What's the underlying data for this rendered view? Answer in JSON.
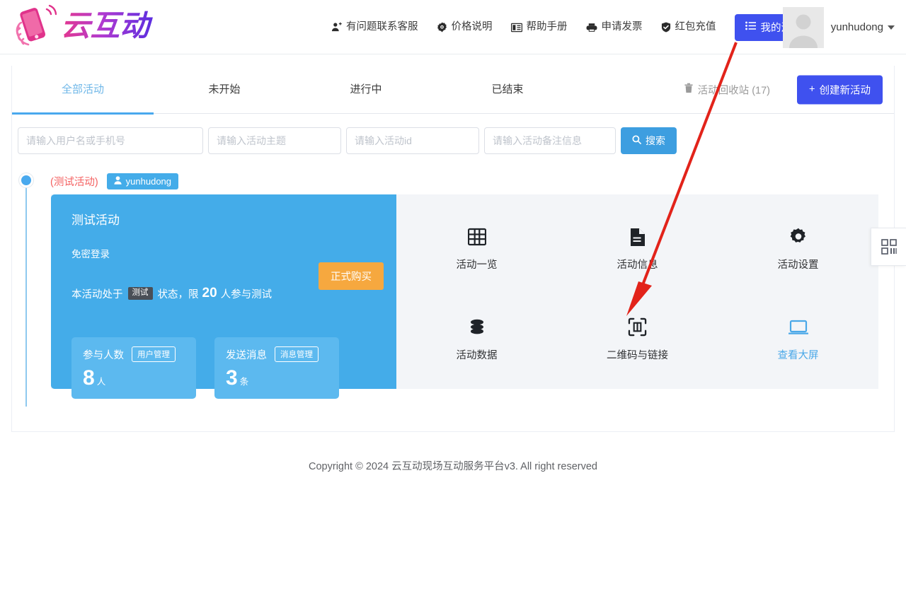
{
  "header": {
    "logo_text": "云互动",
    "logo_icon": "hand-phone-logo-icon",
    "nav": [
      {
        "icon": "user-support-icon",
        "label": "有问题联系客服"
      },
      {
        "icon": "gear-badge-icon",
        "label": "价格说明"
      },
      {
        "icon": "book-icon",
        "label": "帮助手册"
      },
      {
        "icon": "printer-icon",
        "label": "申请发票"
      },
      {
        "icon": "shield-check-icon",
        "label": "红包充值"
      }
    ],
    "my_activities_button": {
      "icon": "list-icon",
      "label": "我的活动"
    },
    "user": {
      "name": "yunhudong",
      "avatar_icon": "avatar-placeholder-icon",
      "caret": "chevron-down-icon"
    }
  },
  "tabs": [
    {
      "label": "全部活动",
      "active": true
    },
    {
      "label": "未开始",
      "active": false
    },
    {
      "label": "进行中",
      "active": false
    },
    {
      "label": "已结束",
      "active": false
    }
  ],
  "recycle_bin": {
    "icon": "trash-icon",
    "label": "活动回收站 (17)"
  },
  "create_button": {
    "icon": "plus-icon",
    "label": "创建新活动"
  },
  "search": {
    "fields": [
      {
        "name": "username-or-phone",
        "placeholder": "请输入用户名或手机号",
        "value": ""
      },
      {
        "name": "activity-title",
        "placeholder": "请输入活动主题",
        "value": ""
      },
      {
        "name": "activity-id",
        "placeholder": "请输入活动id",
        "value": ""
      },
      {
        "name": "activity-remark",
        "placeholder": "请输入活动备注信息",
        "value": ""
      }
    ],
    "button": {
      "icon": "search-icon",
      "label": "搜索"
    }
  },
  "activity": {
    "badge_text": "(测试活动)",
    "owner_tag": {
      "icon": "user-icon",
      "label": "yunhudong"
    },
    "name": "测试活动",
    "subtitle": "免密登录",
    "status": {
      "prefix": "本活动处于",
      "chip": "测试",
      "middle": "状态，限",
      "limit": "20",
      "suffix": "人参与测试"
    },
    "buy_button": "正式购买",
    "stats": [
      {
        "label": "参与人数",
        "action": "用户管理",
        "value": "8",
        "unit": "人"
      },
      {
        "label": "发送消息",
        "action": "消息管理",
        "value": "3",
        "unit": "条"
      }
    ],
    "tools": [
      {
        "icon": "grid-icon",
        "label": "活动一览",
        "accent": false
      },
      {
        "icon": "document-icon",
        "label": "活动信息",
        "accent": false
      },
      {
        "icon": "gear-icon",
        "label": "活动设置",
        "accent": false
      },
      {
        "icon": "database-icon",
        "label": "活动数据",
        "accent": false
      },
      {
        "icon": "qrcode-scan-icon",
        "label": "二维码与链接",
        "accent": false
      },
      {
        "icon": "monitor-icon",
        "label": "查看大屏",
        "accent": true
      }
    ]
  },
  "side_widget": {
    "icon": "qrcode-icon"
  },
  "footer": {
    "text": "Copyright © 2024 云互动现场互动服务平台v3. All right reserved"
  },
  "annotation": {
    "type": "red-arrow",
    "color": "#e2231a"
  },
  "colors": {
    "brand_blue": "#3f51ef",
    "card_blue": "#44ace9",
    "stat_blue": "#5cb9ef",
    "accent_link": "#4aa8e8",
    "buy_orange": "#f6a83f",
    "red_text": "#f46060",
    "search_blue": "#3d9ee0",
    "panel_gray": "#f3f5f8"
  }
}
